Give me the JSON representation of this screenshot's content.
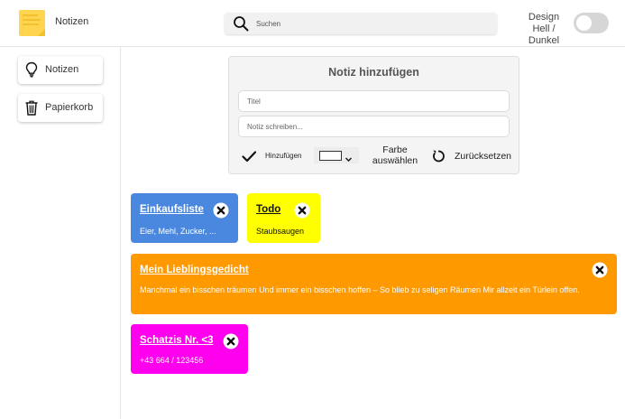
{
  "header": {
    "app_title": "Notizen",
    "search_placeholder": "Suchen",
    "theme_line1": "Design",
    "theme_line2": "Hell / Dunkel",
    "theme_dark_enabled": false
  },
  "sidebar": {
    "items": [
      {
        "label": "Notizen",
        "icon": "lightbulb-icon"
      },
      {
        "label": "Papierkorb",
        "icon": "trash-icon"
      }
    ]
  },
  "form": {
    "title": "Notiz hinzufügen",
    "title_placeholder": "Titel",
    "body_placeholder": "Notiz schreiben...",
    "add_label": "Hinzufügen",
    "selected_color": "#ffffff",
    "color_label_line1": "Farbe",
    "color_label_line2": "auswählen",
    "reset_label": "Zurücksetzen"
  },
  "notes": [
    {
      "title": "Einkaufsliste",
      "body": "Eier, Mehl, Zucker, ...",
      "color": "#4a88e0",
      "text_color": "#ffffff"
    },
    {
      "title": "Todo",
      "body": "Staubsaugen",
      "color": "#ffff00",
      "text_color": "#111111"
    },
    {
      "title": "Mein Lieblingsgedicht",
      "body": "Manchmal ein bisschen träumen Und immer ein bisschen hoffen – So blieb zu seligen Räumen Mir allzeit ein Türlein offen.",
      "color": "#ff9900",
      "text_color": "#ffffff"
    },
    {
      "title": "Schatzis Nr. <3",
      "body": "+43 664 / 123456",
      "color": "#ff00ee",
      "text_color": "#ffffff"
    }
  ],
  "colors": {
    "logo_yellow": "#ffd54f",
    "accent_dark": "#111111"
  }
}
